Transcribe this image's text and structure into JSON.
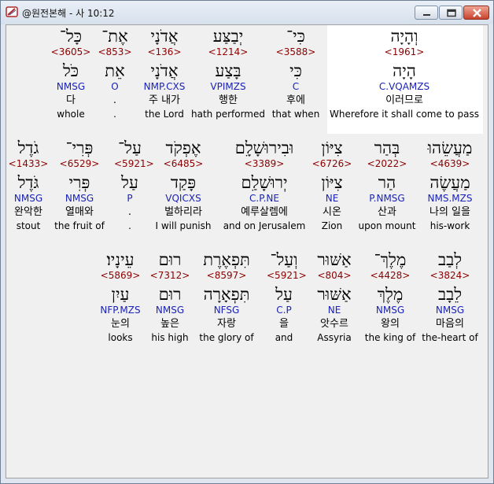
{
  "window": {
    "title": "@원전본해 - 사 10:12"
  },
  "rows": [
    [
      {
        "hebrew": "וְהָיָה",
        "strong": "<1961>",
        "lemma": "הָיָה",
        "morph": "C.VQAMZS",
        "korean": "이러므로",
        "english": "Wherefore it shall come to pass"
      },
      {
        "hebrew": "כִּי־",
        "strong": "<3588>",
        "lemma": "כִּי",
        "morph": "C",
        "korean": "후에",
        "english": "that when"
      },
      {
        "hebrew": "יְבַצַּע",
        "strong": "<1214>",
        "lemma": "בָּצַע",
        "morph": "VPIMZS",
        "korean": "행한",
        "english": "hath performed"
      },
      {
        "hebrew": "אֲדֹנָי",
        "strong": "<136>",
        "lemma": "אֲדֹנָי",
        "morph": "NMP.CXS",
        "korean": "주 내가",
        "english": "the Lord"
      },
      {
        "hebrew": "אֶת־",
        "strong": "<853>",
        "lemma": "אֵת",
        "morph": "O",
        "korean": ".",
        "english": "."
      },
      {
        "hebrew": "כָּל־",
        "strong": "<3605>",
        "lemma": "כֹּל",
        "morph": "NMSG",
        "korean": "다",
        "english": "whole"
      }
    ],
    [
      {
        "hebrew": "מַעֲשֵׂהוּ",
        "strong": "<4639>",
        "lemma": "מַעֲשֶׂה",
        "morph": "NMS.MZS",
        "korean": "나의 일을",
        "english": "his-work"
      },
      {
        "hebrew": "בְּהַר",
        "strong": "<2022>",
        "lemma": "הַר",
        "morph": "P.NMSG",
        "korean": "산과",
        "english": "upon mount"
      },
      {
        "hebrew": "צִיּוֹן",
        "strong": "<6726>",
        "lemma": "צִיּוֹן",
        "morph": "NE",
        "korean": "시온",
        "english": "Zion"
      },
      {
        "hebrew": "וּבִירוּשָׁלִָם",
        "strong": "<3389>",
        "lemma": "יְרוּשָׁלִַם",
        "morph": "C.P.NE",
        "korean": "예루살렘에",
        "english": "and on Jerusalem"
      },
      {
        "hebrew": "אֶפְקֹד",
        "strong": "<6485>",
        "lemma": "פָּקַד",
        "morph": "VQICXS",
        "korean": "벌하리라",
        "english": "I will punish"
      },
      {
        "hebrew": "עַל־",
        "strong": "<5921>",
        "lemma": "עַל",
        "morph": "P",
        "korean": ".",
        "english": "."
      },
      {
        "hebrew": "פְּרִי־",
        "strong": "<6529>",
        "lemma": "פְּרִי",
        "morph": "NMSG",
        "korean": "열매와",
        "english": "the fruit of"
      },
      {
        "hebrew": "גֹדֶל",
        "strong": "<1433>",
        "lemma": "גֹּדֶל",
        "morph": "NMSG",
        "korean": "완악한",
        "english": "stout"
      }
    ],
    [
      {
        "hebrew": "לְבַב",
        "strong": "<3824>",
        "lemma": "לֵבָב",
        "morph": "NMSG",
        "korean": "마음의",
        "english": "the-heart of"
      },
      {
        "hebrew": "מֶלֶךְ־",
        "strong": "<4428>",
        "lemma": "מֶלֶךְ",
        "morph": "NMSG",
        "korean": "왕의",
        "english": "the king of"
      },
      {
        "hebrew": "אַשּׁוּר",
        "strong": "<804>",
        "lemma": "אַשּׁוּר",
        "morph": "NE",
        "korean": "앗수르",
        "english": "Assyria"
      },
      {
        "hebrew": "וְעַל־",
        "strong": "<5921>",
        "lemma": "עַל",
        "morph": "C.P",
        "korean": "을",
        "english": "and"
      },
      {
        "hebrew": "תִּפְאֶרֶת",
        "strong": "<8597>",
        "lemma": "תִּפְאָרָה",
        "morph": "NFSG",
        "korean": "자랑",
        "english": "the glory of"
      },
      {
        "hebrew": "רוּם",
        "strong": "<7312>",
        "lemma": "רוּם",
        "morph": "NMSG",
        "korean": "높은",
        "english": "his high"
      },
      {
        "hebrew": "עֵינָיו׃",
        "strong": "<5869>",
        "lemma": "עַיִן",
        "morph": "NFP.MZS",
        "korean": "눈의",
        "english": "looks"
      }
    ]
  ],
  "colors": {
    "strong": "#8b0000",
    "morph": "#1a22b8",
    "highlight": "#ffffff",
    "background": "#f0f0f0"
  },
  "icons": {
    "app": "bible-book-icon",
    "minimize": "minimize-icon",
    "maximize": "maximize-icon",
    "close": "close-icon"
  }
}
